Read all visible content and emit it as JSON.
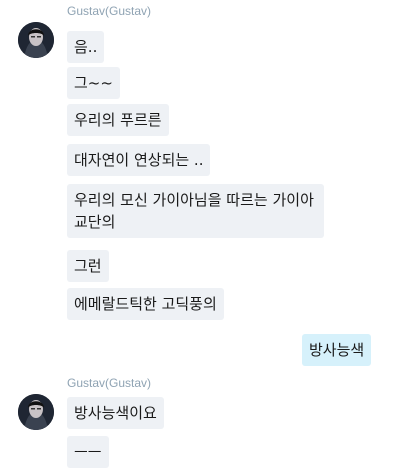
{
  "messages_group_1": {
    "sender": "Gustav(Gustav)",
    "bubbles": [
      "음..",
      "그~~",
      "우리의 푸르른",
      "대자연이 연상되는 ..",
      "우리의 모신 가이아님을 따르는 가이아 교단의",
      "그런",
      "에메랄드틱한 고딕풍의"
    ]
  },
  "my_message": "방사능색",
  "messages_group_2": {
    "sender": "Gustav(Gustav)",
    "bubbles": [
      "방사능색이요",
      "ㅡㅡ"
    ]
  },
  "colors": {
    "incoming_bubble": "#eef1f5",
    "outgoing_bubble": "#d6f1fb",
    "sender_name": "#8fa3b3"
  }
}
